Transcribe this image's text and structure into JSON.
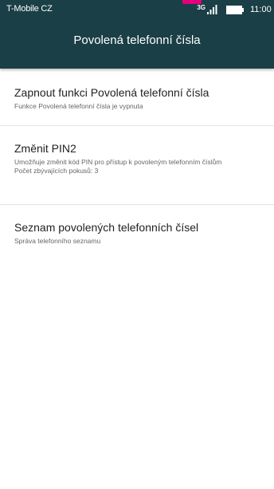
{
  "status_bar": {
    "carrier": "T-Mobile CZ",
    "network_type": "3G",
    "time": "11:00",
    "signal_icon": "signal-strength-icon",
    "battery_icon": "battery-icon"
  },
  "action_bar": {
    "title": "Povolená telefonní čísla"
  },
  "preferences": [
    {
      "title": "Zapnout funkci Povolená telefonní čísla",
      "summary": "Funkce Povolená telefonní čísla je vypnuta"
    },
    {
      "title": "Změnit PIN2",
      "summary_line_1": "Umožňuje změnit kód PIN pro přístup k povoleným telefonním číslům",
      "summary_line_2": "Počet zbývajících pokusů: 3"
    },
    {
      "title": "Seznam povolených telefonních čísel",
      "summary": "Správa telefonního seznamu"
    }
  ],
  "colors": {
    "action_bar": "#1a3f47",
    "notification_mark": "#e4007c",
    "background": "#ffffff"
  }
}
